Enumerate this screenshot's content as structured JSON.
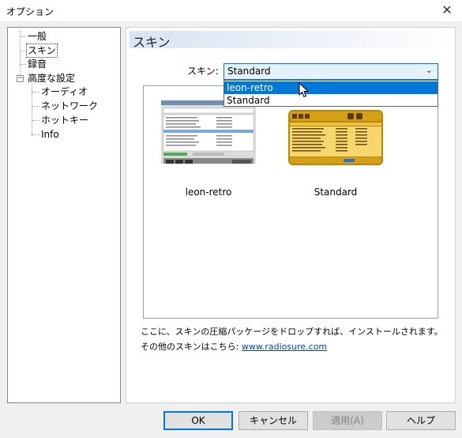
{
  "window": {
    "title": "オプション",
    "close_glyph": "✕"
  },
  "tree": {
    "items": [
      {
        "label": "一般"
      },
      {
        "label": "スキン"
      },
      {
        "label": "録音"
      },
      {
        "label": "高度な設定",
        "expander": "−"
      },
      {
        "label": "オーディオ"
      },
      {
        "label": "ネットワーク"
      },
      {
        "label": "ホットキー"
      },
      {
        "label": "Info"
      }
    ]
  },
  "panel": {
    "header": "スキン",
    "skin_label": "スキン:",
    "combo": {
      "value": "Standard",
      "arrow": "⌄"
    },
    "dropdown_options": [
      "leon-retro",
      "Standard"
    ],
    "highlighted_option": "leon-retro",
    "skins": [
      {
        "name": "leon-retro"
      },
      {
        "name": "Standard"
      }
    ],
    "note": "ここに、スキンの圧縮パッケージをドロップすれば、インストールされます。",
    "more_prefix": "その他のスキンはこちら:",
    "more_link": "www.radiosure.com"
  },
  "buttons": {
    "ok": "OK",
    "cancel": "キャンセル",
    "apply": "適用(A)",
    "help": "ヘルプ"
  },
  "colors": {
    "accent": "#0078d7",
    "link": "#0645ad"
  }
}
